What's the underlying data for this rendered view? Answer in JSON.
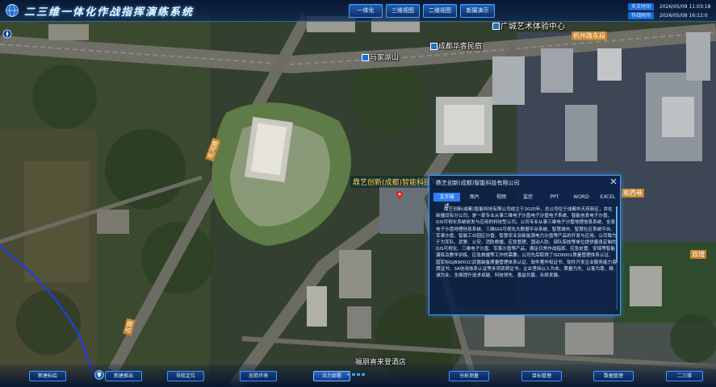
{
  "app": {
    "title": "二三维一体化作战指挥演练系统"
  },
  "top_tabs": [
    "一体化",
    "三维视图",
    "二维视图",
    "新展演示"
  ],
  "top_right": {
    "btn1": "天文时间",
    "btn2": "作战时间",
    "time1": "2026/05/09 11:03:18",
    "time2": "2026/05/08 16:12:0"
  },
  "map_labels": {
    "guangcheng": "广城艺术体验中心",
    "hangkang": "杭州路东段",
    "chengdu_guest": "成都华客民宿",
    "mahuanfu": "马家湖山",
    "road_left": "毛河路",
    "road_right": "和西巷",
    "road_bottom": "古路",
    "shuangxin": "双增",
    "hotel": "福朋喜来登酒店",
    "highlight": "鼎艺创新(成都)智能科技有"
  },
  "popup": {
    "title": "鼎艺创新(成都)智能科技有限公司",
    "tabs": [
      "文字描述",
      "图片",
      "视频",
      "监控",
      "PPT",
      "WORD",
      "EXCEL"
    ],
    "active_tab": 0,
    "body": "鼎艺创新(成都)智能科技有限公司成立于2020年，总公司位于成都市天府新区，并在新疆设有分公司，是一家专业从事三维电子沙盘电子沙盘电子系统、智能信息电子沙盘、GIS可视化系统研发与应用的科技型公司。公司专业从事三维电子沙盘地理信息系统、全息电子沙盘地理信息系统、三维GIS可视化大数据平台系统、智慧城市、智慧社区系统平台、军事沙盘、智能工业园区沙盘、智慧农业及新能源电力沙盘等产品的开发与应用。公司致力于为军队、武警、公安、消防救援、应急管理、国动人防、部队院校等单位提供量身定制的GIS可视化、三维电子沙盘、军事沙盘等产品，满足日常作战指挥、应急处置、安保等智能演练及教学训练、应急救援等工作的需要。公司先后取得了ISO9001质量管理体系认证、国军标GJB9001C武器装备质量管理体系认证、软件著作权证书、软件开发企业服务能力资质证书、3A信用体系认证等多项资质证书。企业坚持以人为本、质量为先、以客为尊，精诚为业，全面提升追求卓越、科技领先、善益共赢、永续发展。"
  },
  "bottom_buttons": [
    "新建标绘",
    "新建推出",
    "导航定位",
    "态势环境",
    "兵力部署",
    "分析测量",
    "目标管理",
    "数据管理",
    "二三维"
  ],
  "bottom_active": 4
}
